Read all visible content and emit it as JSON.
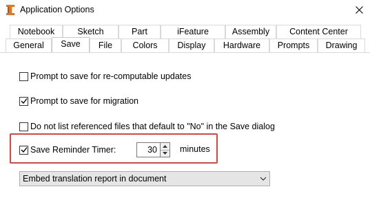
{
  "window": {
    "title": "Application Options",
    "app_icon": "inventor-i-icon",
    "close_icon": "close-icon"
  },
  "tabs": {
    "row1": [
      {
        "label": "Notebook"
      },
      {
        "label": "Sketch"
      },
      {
        "label": "Part"
      },
      {
        "label": "iFeature"
      },
      {
        "label": "Assembly"
      },
      {
        "label": "Content Center"
      }
    ],
    "row2": [
      {
        "label": "General"
      },
      {
        "label": "Save",
        "active": true
      },
      {
        "label": "File"
      },
      {
        "label": "Colors"
      },
      {
        "label": "Display"
      },
      {
        "label": "Hardware"
      },
      {
        "label": "Prompts"
      },
      {
        "label": "Drawing"
      }
    ]
  },
  "save_options": {
    "prompt_recompute": {
      "label": "Prompt to save for re-computable updates",
      "checked": false
    },
    "prompt_migration": {
      "label": "Prompt to save for migration",
      "checked": true
    },
    "no_list_referenced": {
      "label": "Do not list referenced files that default to \"No\" in the Save dialog",
      "checked": false
    },
    "reminder_timer": {
      "label": "Save Reminder Timer:",
      "checked": true,
      "value": "30",
      "units": "minutes"
    },
    "translation_report": {
      "selected": "Embed translation report in document"
    }
  },
  "colors": {
    "highlight": "#e0443e",
    "app_icon": "#e8731a"
  }
}
